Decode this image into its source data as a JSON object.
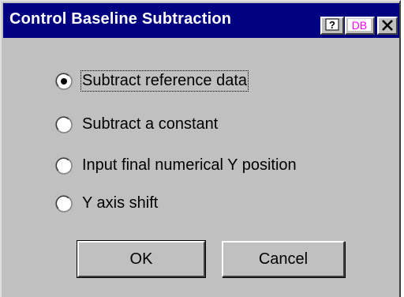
{
  "dialog": {
    "title": "Control Baseline Subtraction",
    "titlebar_buttons": [
      {
        "icon": "help-icon"
      },
      {
        "icon": "db-icon",
        "label": "DB"
      },
      {
        "icon": "close-icon",
        "label": "X"
      }
    ]
  },
  "options": [
    {
      "label": "Subtract reference data",
      "selected": true
    },
    {
      "label": "Subtract a constant",
      "selected": false
    },
    {
      "label": "Input final numerical Y position",
      "selected": false
    },
    {
      "label": "Y axis shift",
      "selected": false
    }
  ],
  "buttons": {
    "ok_label": "OK",
    "cancel_label": "Cancel"
  },
  "colors": {
    "titlebar": "#000080",
    "dialog_face": "#c0c0c0",
    "db_icon": "#ff00ff"
  }
}
